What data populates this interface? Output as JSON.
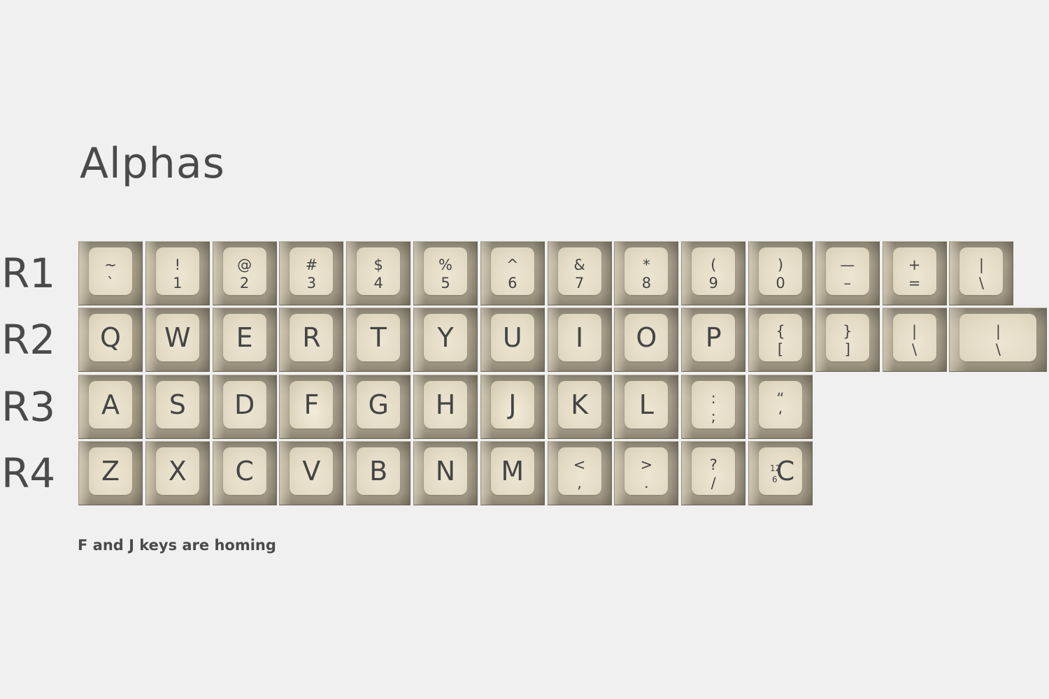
{
  "title": "Alphas",
  "note": "F and J keys are homing",
  "colors": {
    "background": "#f0f0f0",
    "keycap_body": "#b4ab95",
    "keycap_top": "#e6dec8",
    "legend": "#454545"
  },
  "rows": [
    {
      "label": "R1",
      "keys": [
        {
          "top": "~",
          "bottom": "`"
        },
        {
          "top": "!",
          "bottom": "1"
        },
        {
          "top": "@",
          "bottom": "2"
        },
        {
          "top": "#",
          "bottom": "3"
        },
        {
          "top": "$",
          "bottom": "4"
        },
        {
          "top": "%",
          "bottom": "5"
        },
        {
          "top": "^",
          "bottom": "6"
        },
        {
          "top": "&",
          "bottom": "7"
        },
        {
          "top": "*",
          "bottom": "8"
        },
        {
          "top": "(",
          "bottom": "9"
        },
        {
          "top": ")",
          "bottom": "0"
        },
        {
          "top": "—",
          "bottom": "–"
        },
        {
          "top": "+",
          "bottom": "="
        },
        {
          "top": "|",
          "bottom": "\\"
        }
      ]
    },
    {
      "label": "R2",
      "keys": [
        {
          "main": "Q"
        },
        {
          "main": "W"
        },
        {
          "main": "E"
        },
        {
          "main": "R"
        },
        {
          "main": "T"
        },
        {
          "main": "Y"
        },
        {
          "main": "U"
        },
        {
          "main": "I"
        },
        {
          "main": "O"
        },
        {
          "main": "P"
        },
        {
          "top": "{",
          "bottom": "["
        },
        {
          "top": "}",
          "bottom": "]"
        },
        {
          "top": "|",
          "bottom": "\\"
        },
        {
          "top": "|",
          "bottom": "\\"
        }
      ]
    },
    {
      "label": "R3",
      "keys": [
        {
          "main": "A"
        },
        {
          "main": "S"
        },
        {
          "main": "D"
        },
        {
          "main": "F",
          "homing": true
        },
        {
          "main": "G"
        },
        {
          "main": "H"
        },
        {
          "main": "J",
          "homing": true
        },
        {
          "main": "K"
        },
        {
          "main": "L"
        },
        {
          "top": ":",
          "bottom": ";"
        },
        {
          "top": "“",
          "bottom": "‘"
        }
      ]
    },
    {
      "label": "R4",
      "keys": [
        {
          "main": "Z"
        },
        {
          "main": "X"
        },
        {
          "main": "C"
        },
        {
          "main": "V"
        },
        {
          "main": "B"
        },
        {
          "main": "N"
        },
        {
          "main": "M"
        },
        {
          "top": "<",
          "bottom": ","
        },
        {
          "top": ">",
          "bottom": "."
        },
        {
          "top": "?",
          "bottom": "/"
        },
        {
          "main": "C",
          "clock_top": "12",
          "clock_bottom": "6"
        }
      ]
    }
  ]
}
